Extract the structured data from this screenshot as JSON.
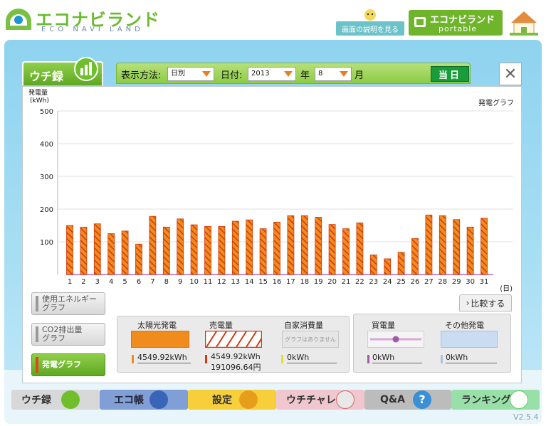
{
  "header": {
    "logo_main": "エコナビランド",
    "logo_sub": "ECO NAVI LAND",
    "help_label": "画面の説明を見る",
    "portable_main": "エコナビランド",
    "portable_sub": "portable"
  },
  "toolbar": {
    "tab_label": "ウチ録",
    "display_label": "表示方法:",
    "display_value": "日別",
    "date_label": "日付:",
    "year_value": "2013",
    "year_unit": "年",
    "month_value": "8",
    "month_unit": "月",
    "today_label": "当日",
    "close_label": "✕"
  },
  "chart_data": {
    "type": "bar",
    "title": "発電グラフ",
    "ylabel_line1": "発電量",
    "ylabel_line2": "(kWh)",
    "xlabel": "(日)",
    "ylim": [
      0,
      500
    ],
    "yticks": [
      "500",
      "400",
      "300",
      "200",
      "100"
    ],
    "categories": [
      "1",
      "2",
      "3",
      "4",
      "5",
      "6",
      "7",
      "8",
      "9",
      "10",
      "11",
      "12",
      "13",
      "14",
      "15",
      "16",
      "17",
      "18",
      "19",
      "20",
      "21",
      "22",
      "23",
      "24",
      "25",
      "26",
      "27",
      "28",
      "29",
      "30",
      "31"
    ],
    "values": [
      150,
      145,
      155,
      125,
      133,
      93,
      178,
      145,
      170,
      152,
      147,
      147,
      163,
      167,
      140,
      160,
      180,
      180,
      175,
      153,
      140,
      158,
      60,
      48,
      68,
      110,
      182,
      180,
      168,
      145,
      172
    ],
    "bar_color": "#f08c1e",
    "bar_stripe_color": "#d23a10",
    "baseline_color": "#c58ec8"
  },
  "side_buttons": [
    {
      "label_line1": "使用エネルギー",
      "label_line2": "グラフ"
    },
    {
      "label_line1": "CO2排出量",
      "label_line2": "グラフ"
    },
    {
      "label_line1": "発電グラフ",
      "label_line2": ""
    }
  ],
  "compare_label": "比較する",
  "legend": {
    "solar": {
      "title": "太陽光発電",
      "value": "4549.92kWh"
    },
    "sell": {
      "title": "売電量",
      "value": "4549.92kWh",
      "yen": "191096.64円"
    },
    "self": {
      "title": "自家消費量",
      "note": "グラフはありません",
      "value": "0kWh"
    },
    "buy": {
      "title": "買電量",
      "value": "0kWh"
    },
    "other": {
      "title": "その他発電",
      "value": "0kWh"
    }
  },
  "bottom_nav": [
    {
      "label": "ウチ録"
    },
    {
      "label": "エコ帳"
    },
    {
      "label": "設定"
    },
    {
      "label": "ウチチャレ"
    },
    {
      "label": "Q&A"
    },
    {
      "label": "ランキング"
    }
  ],
  "version": "V2.5.4"
}
